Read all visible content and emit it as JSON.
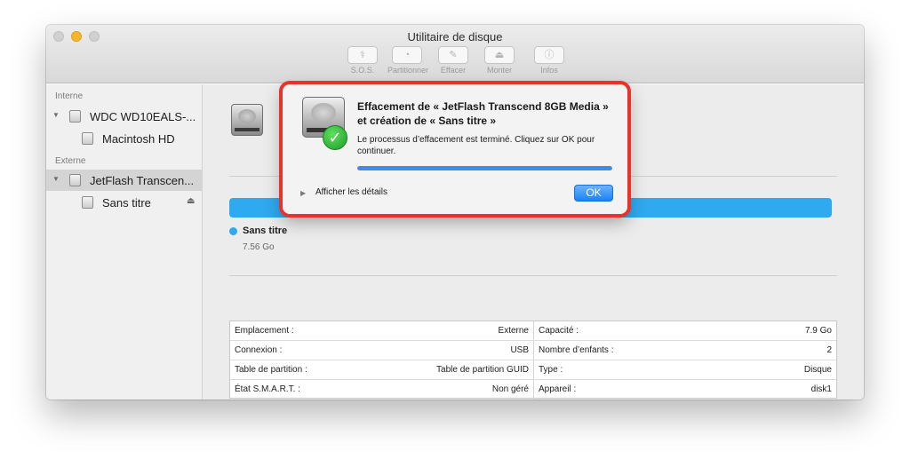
{
  "window": {
    "title": "Utilitaire de disque"
  },
  "toolbar": {
    "items": [
      {
        "label": "S.O.S.",
        "glyph": "⚕"
      },
      {
        "label": "Partitionner",
        "glyph": "◔"
      },
      {
        "label": "Effacer",
        "glyph": "✎"
      },
      {
        "label": "Monter",
        "glyph": "⏏"
      },
      {
        "label": "Infos",
        "glyph": "ⓘ"
      }
    ]
  },
  "sidebar": {
    "internal_label": "Interne",
    "external_label": "Externe",
    "items": [
      {
        "label": "WDC WD10EALS-...",
        "icon": "internal-disk-icon"
      },
      {
        "label": "Macintosh HD",
        "icon": "volume-icon"
      },
      {
        "label": "JetFlash Transcen...",
        "icon": "external-disk-icon"
      },
      {
        "label": "Sans titre",
        "icon": "volume-icon"
      }
    ]
  },
  "volume": {
    "name": "Sans titre",
    "size": "7.56 Go",
    "usage_color": "#2fa9ef"
  },
  "info_table": {
    "rows": [
      {
        "left_label": "Emplacement :",
        "left_value": "Externe",
        "right_label": "Capacité :",
        "right_value": "7.9 Go"
      },
      {
        "left_label": "Connexion :",
        "left_value": "USB",
        "right_label": "Nombre d’enfants :",
        "right_value": "2"
      },
      {
        "left_label": "Table de partition :",
        "left_value": "Table de partition GUID",
        "right_label": "Type :",
        "right_value": "Disque"
      },
      {
        "left_label": "État S.M.A.R.T. :",
        "left_value": "Non géré",
        "right_label": "Appareil :",
        "right_value": "disk1"
      }
    ]
  },
  "dialog": {
    "title": "Effacement de « JetFlash Transcend 8GB Media » et création de « Sans titre »",
    "message": "Le processus d’effacement est terminé. Cliquez sur OK pour continuer.",
    "progress": 1.0,
    "details_label": "Afficher les détails",
    "ok_label": "OK",
    "highlight_color": "#e8322b"
  }
}
